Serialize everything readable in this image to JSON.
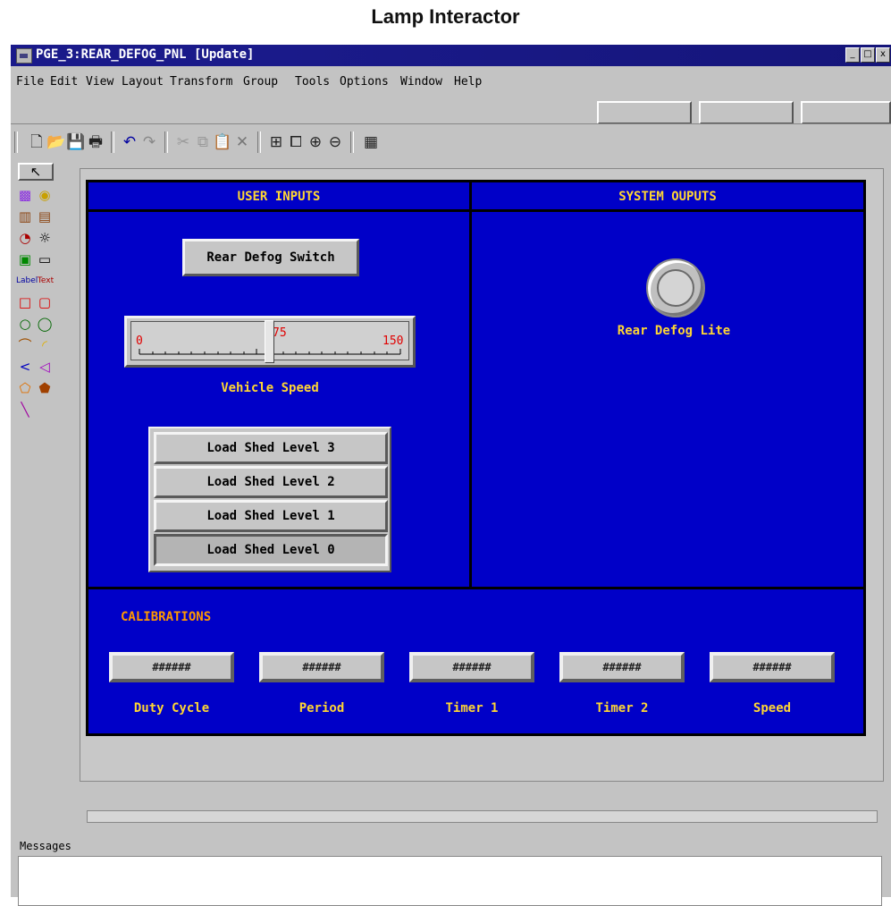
{
  "caption": "Lamp Interactor",
  "window": {
    "title": "PGE_3:REAR_DEFOG_PNL   [Update]",
    "buttons": {
      "minimize": "_",
      "maximize": "□",
      "close": "x"
    }
  },
  "menu": [
    "File",
    "Edit",
    "View",
    "Layout",
    "Transform",
    "Group",
    "Tools",
    "Options",
    "Window",
    "Help"
  ],
  "toolbar_icons": [
    "new-file-icon",
    "open-folder-icon",
    "save-icon",
    "print-icon",
    "undo-icon",
    "redo-icon",
    "cut-icon",
    "copy-icon",
    "paste-icon",
    "delete-icon",
    "fit-view-icon",
    "zoom-window-icon",
    "zoom-in-icon",
    "zoom-out-icon",
    "grid-icon"
  ],
  "panel": {
    "inputs_header": "USER INPUTS",
    "outputs_header": "SYSTEM OUPUTS",
    "switch_button": "Rear Defog Switch",
    "slider": {
      "min_label": "0",
      "mid_label": "75",
      "max_label": "150",
      "caption": "Vehicle Speed",
      "value": 75
    },
    "load_shed": [
      "Load Shed Level 3",
      "Load Shed Level 2",
      "Load Shed Level 1",
      "Load Shed Level 0"
    ],
    "selected_load_shed": "Load Shed Level 0",
    "lamp_label": "Rear Defog Lite",
    "calibrations_header": "CALIBRATIONS",
    "calibrations": [
      {
        "value": "######",
        "label": "Duty Cycle"
      },
      {
        "value": "######",
        "label": "Period"
      },
      {
        "value": "######",
        "label": "Timer 1"
      },
      {
        "value": "######",
        "label": "Timer 2"
      },
      {
        "value": "######",
        "label": "Speed"
      }
    ]
  },
  "palette": {
    "label_tool": "Label",
    "text_tool": "Text"
  },
  "messages": {
    "label": "Messages"
  },
  "colors": {
    "panel_bg": "#0000c8",
    "label_yellow": "#ffd633",
    "title_bar": "#1a1a8a"
  }
}
